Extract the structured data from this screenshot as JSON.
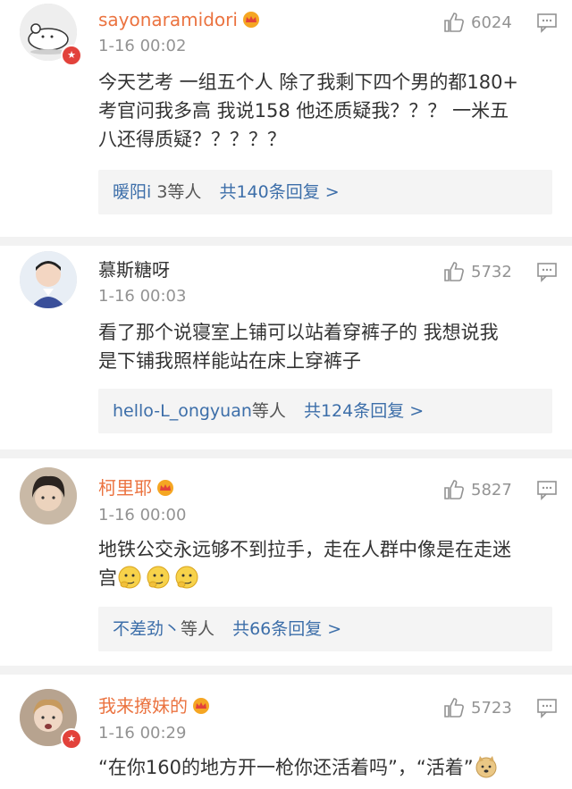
{
  "colors": {
    "accent_username": "#eb7340",
    "link_blue": "#3c6ea9",
    "muted": "#939393",
    "badge_red": "#e2423b"
  },
  "comments": [
    {
      "username": "sayonaramidori",
      "time": "1-16 00:02",
      "likes": "6024",
      "text_lines": [
        "今天艺考 一组五个人 除了我剩下四个男的都180+",
        "考官问我多高 我说158 他还质疑我？？？ 一米五",
        "八还得质疑？？？？？"
      ],
      "replies": {
        "names": "暖阳i",
        "suffix": "3等人",
        "total": "共140条回复 >"
      }
    },
    {
      "username": "慕斯糖呀",
      "time": "1-16 00:03",
      "likes": "5732",
      "text_lines": [
        "看了那个说寝室上铺可以站着穿裤子的 我想说我",
        "是下铺我照样能站在床上穿裤子"
      ],
      "replies": {
        "names": "hello-L_ongyuan",
        "suffix": "等人",
        "total": "共124条回复 >"
      }
    },
    {
      "username": "柯里耶",
      "time": "1-16 00:00",
      "likes": "5827",
      "text_lines": [
        "地铁公交永远够不到拉手，走在人群中像是在走迷",
        "宫"
      ],
      "replies": {
        "names": "不差劲丶",
        "suffix": "等人",
        "total": "共66条回复 >"
      }
    },
    {
      "username": "我来撩妹的",
      "time": "1-16 00:29",
      "likes": "5723",
      "text_lines": [
        "“在你160的地方开一枪你还活着吗”，“活着”"
      ]
    }
  ]
}
